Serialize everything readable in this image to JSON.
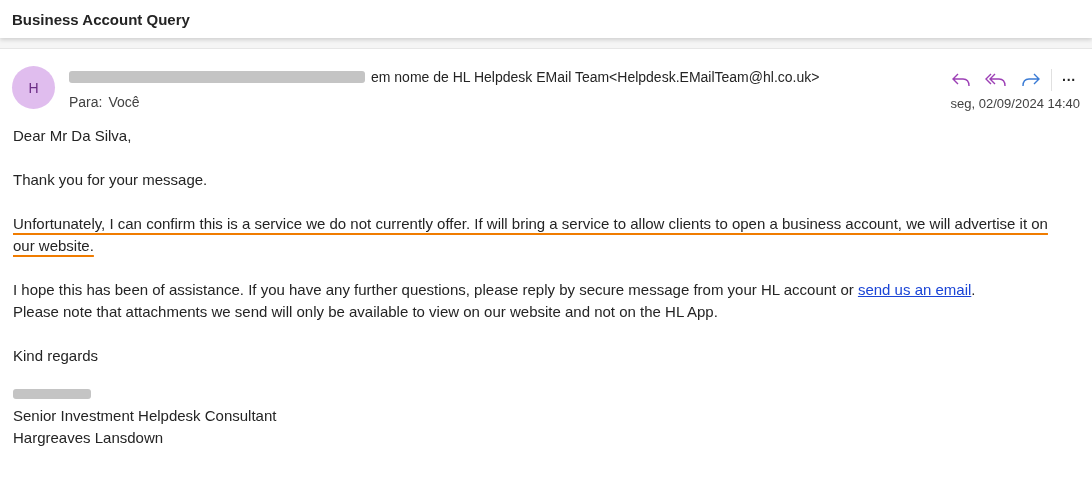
{
  "subject": "Business Account Query",
  "message": {
    "avatar": "H",
    "sender_suffix": "em nome de HL Helpdesk EMail Team<Helpdesk.EMailTeam@hl.co.uk>",
    "to_label": "Para:",
    "to": "Você",
    "date": "seg, 02/09/2024 14:40",
    "actions": [
      {
        "kind": "reply"
      },
      {
        "kind": "reply-all"
      },
      {
        "kind": "forward"
      },
      {
        "kind": "more",
        "label": "···"
      }
    ]
  },
  "body": [
    {
      "underlined": false,
      "lines": [
        {
          "text": "Dear Mr Da Silva,"
        }
      ]
    },
    {
      "underlined": false,
      "lines": [
        {
          "text": "Thank you for your message."
        }
      ]
    },
    {
      "underlined": true,
      "lines": [
        {
          "text": "Unfortunately, I can confirm this is a service we do not currently offer. If will bring a service to allow clients to open a business account, we will advertise it on our website."
        }
      ]
    },
    {
      "underlined": false,
      "lines": [
        {
          "text": "I hope this has been of assistance. If you have any further questions, please reply by secure message from your HL account or ",
          "link": "send us an email",
          "after": "."
        },
        {
          "text": "Please note that attachments we send will only be available to view on our website and not on the HL App."
        }
      ]
    },
    {
      "underlined": false,
      "lines": [
        {
          "text": "Kind regards"
        }
      ]
    }
  ],
  "signature": [
    "Senior Investment Helpdesk Consultant",
    "Hargreaves Lansdown"
  ]
}
